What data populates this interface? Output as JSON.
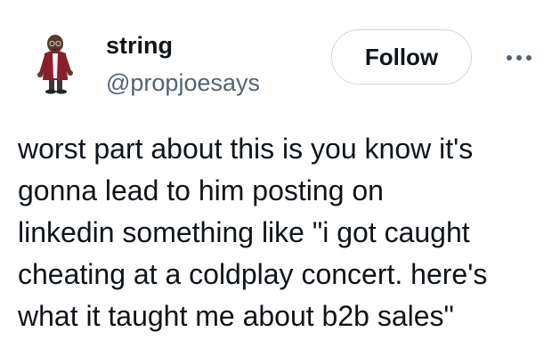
{
  "author": {
    "display_name": "string",
    "handle": "@propjoesays"
  },
  "actions": {
    "follow_label": "Follow",
    "more_icon": "more-horizontal-icon"
  },
  "tweet": {
    "text": "worst part about this is you know it's\ngonna lead to him posting on\nlinkedin something like \"i got caught\ncheating at a coldplay concert. here's\nwhat it taught me about b2b sales\""
  },
  "colors": {
    "text_primary": "#0f1419",
    "text_secondary": "#536471",
    "button_border": "#cfd9de",
    "background": "#ffffff"
  }
}
